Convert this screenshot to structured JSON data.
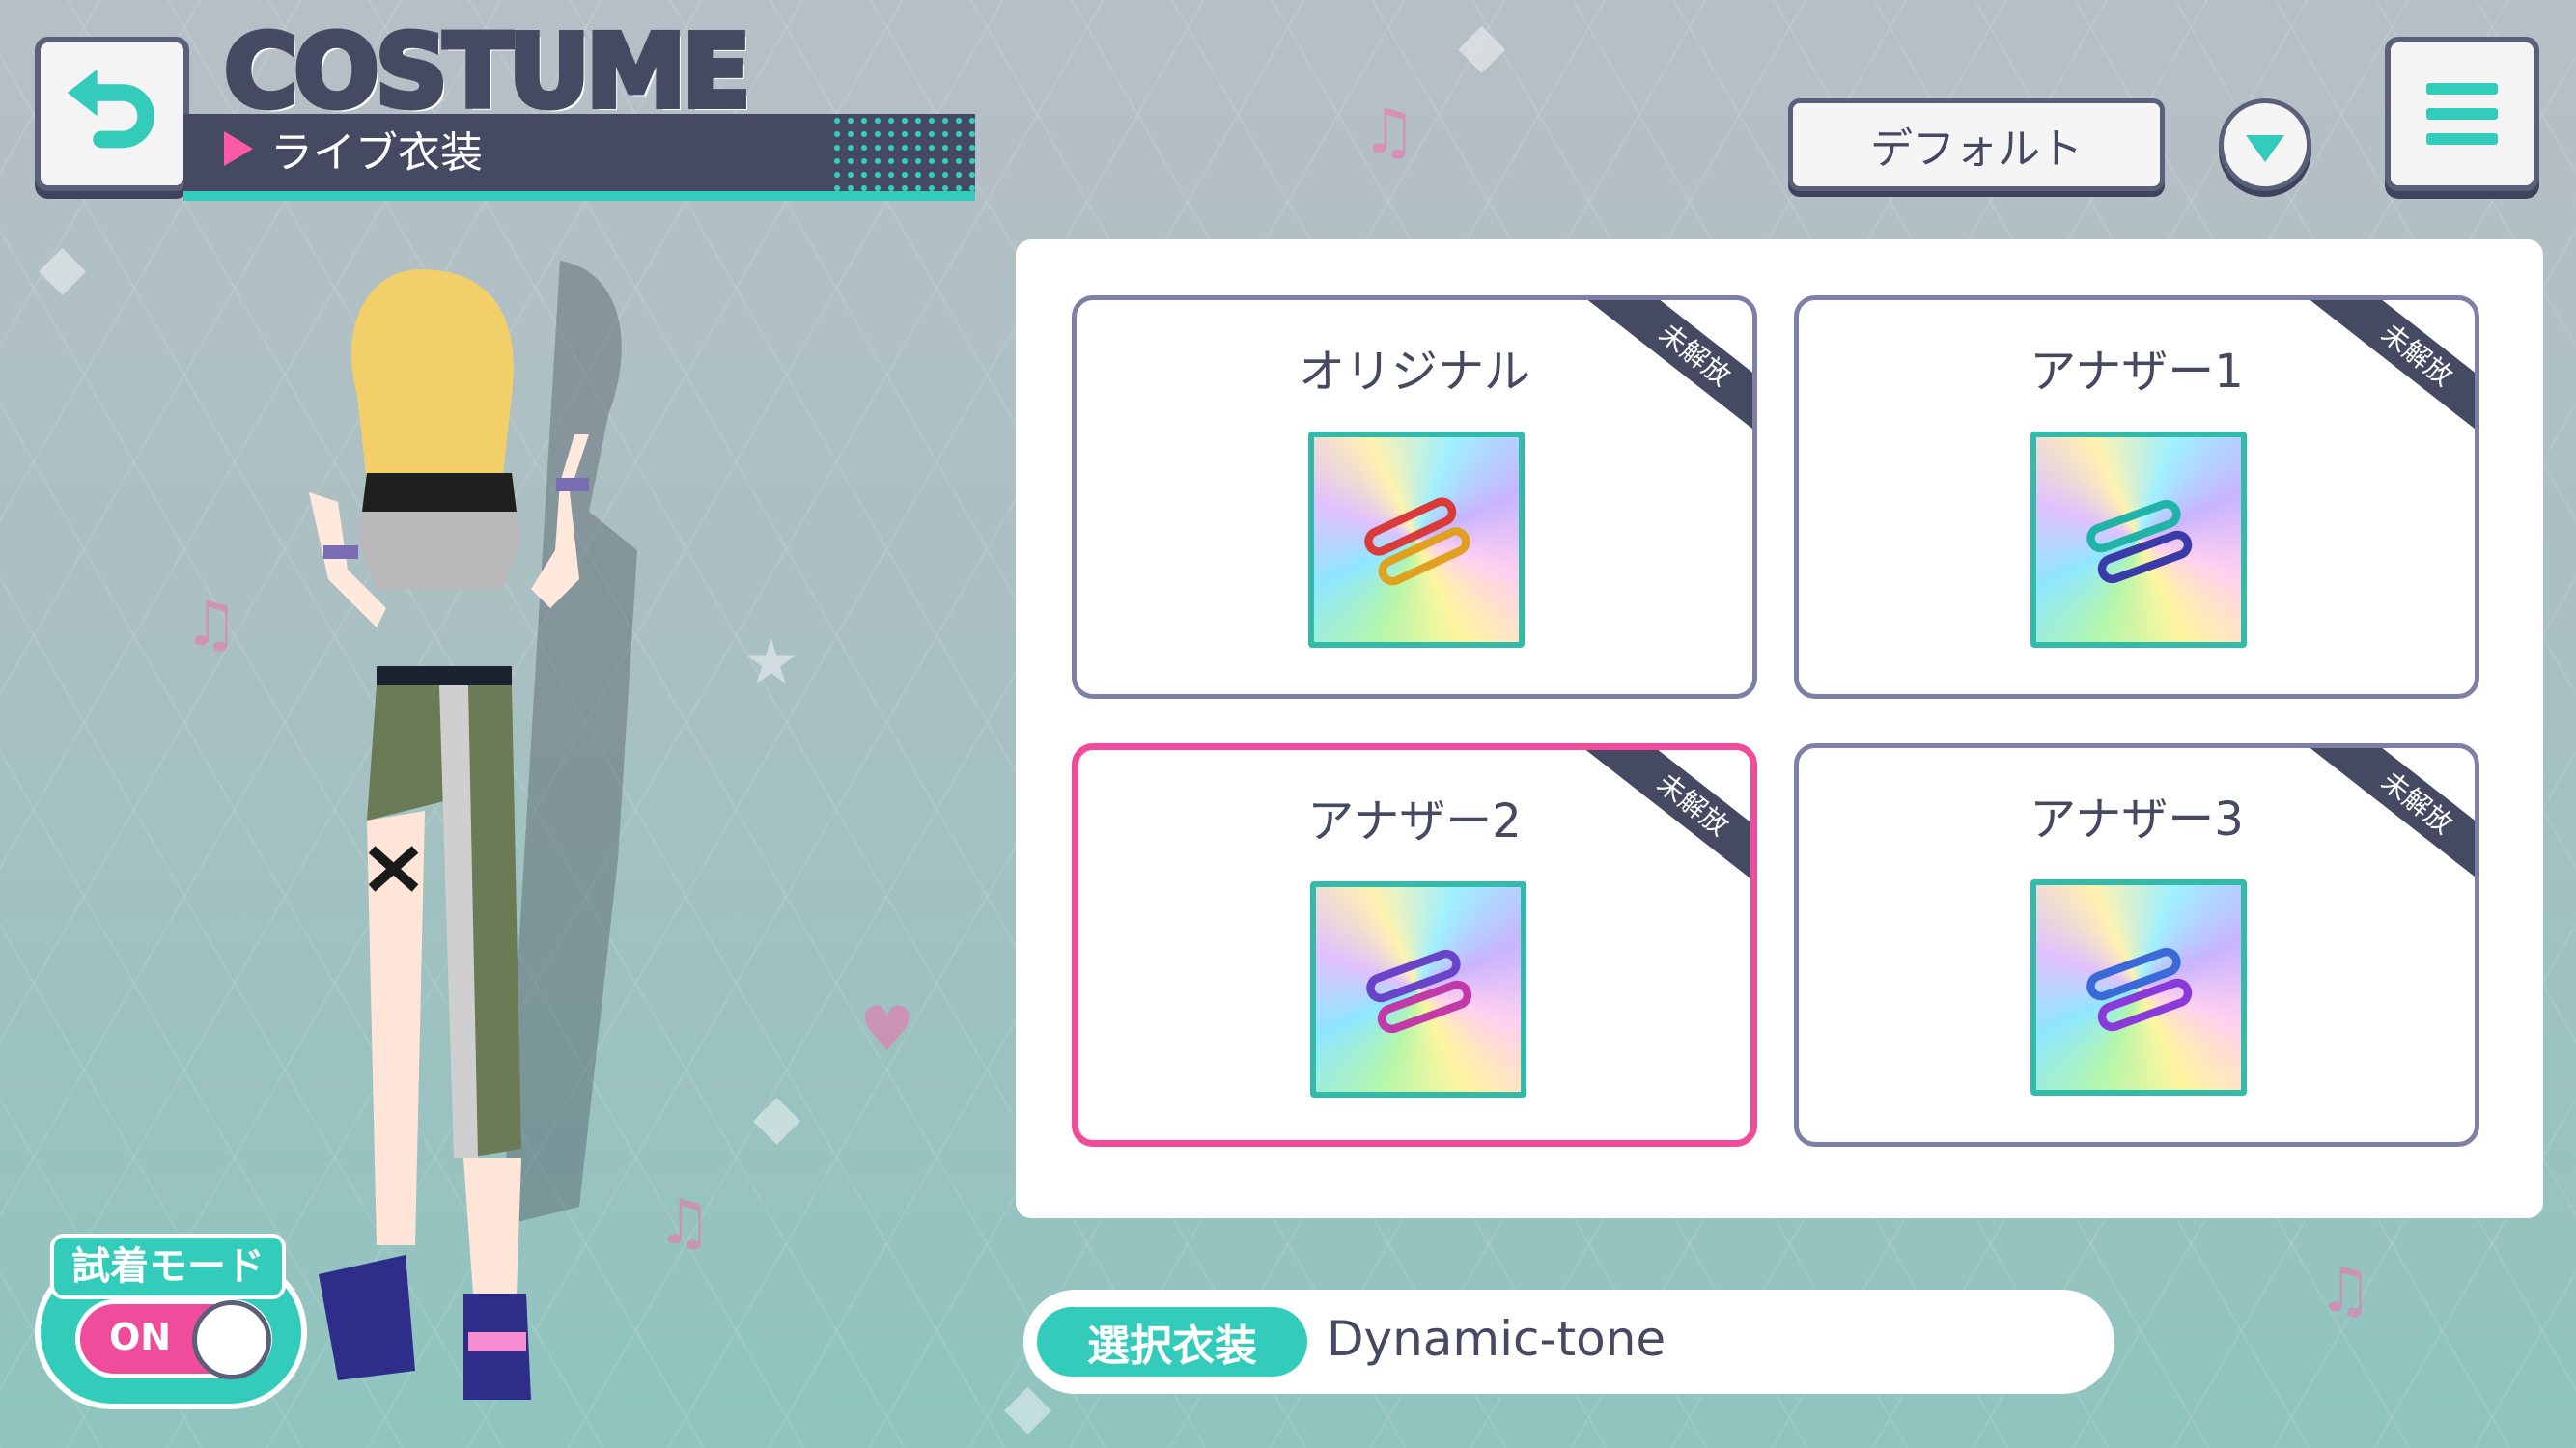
{
  "header": {
    "title": "COSTUME",
    "subtitle": "ライブ衣装"
  },
  "controls": {
    "sort_label": "デフォルト",
    "dropdown_icon": "chevron-down-icon",
    "menu_icon": "hamburger-menu-icon",
    "back_icon": "back-arrow-icon"
  },
  "costumes": [
    {
      "name": "オリジナル",
      "badge": "未解放",
      "selected": false
    },
    {
      "name": "アナザー1",
      "badge": "未解放",
      "selected": false
    },
    {
      "name": "アナザー2",
      "badge": "未解放",
      "selected": true
    },
    {
      "name": "アナザー3",
      "badge": "未解放",
      "selected": false
    }
  ],
  "try_on": {
    "label": "試着モード",
    "state": "ON"
  },
  "selected_costume": {
    "label": "選択衣装",
    "value": "Dynamic-tone"
  },
  "colors": {
    "accent": "#33ccbb",
    "highlight": "#f04c9c",
    "navy": "#454961"
  }
}
